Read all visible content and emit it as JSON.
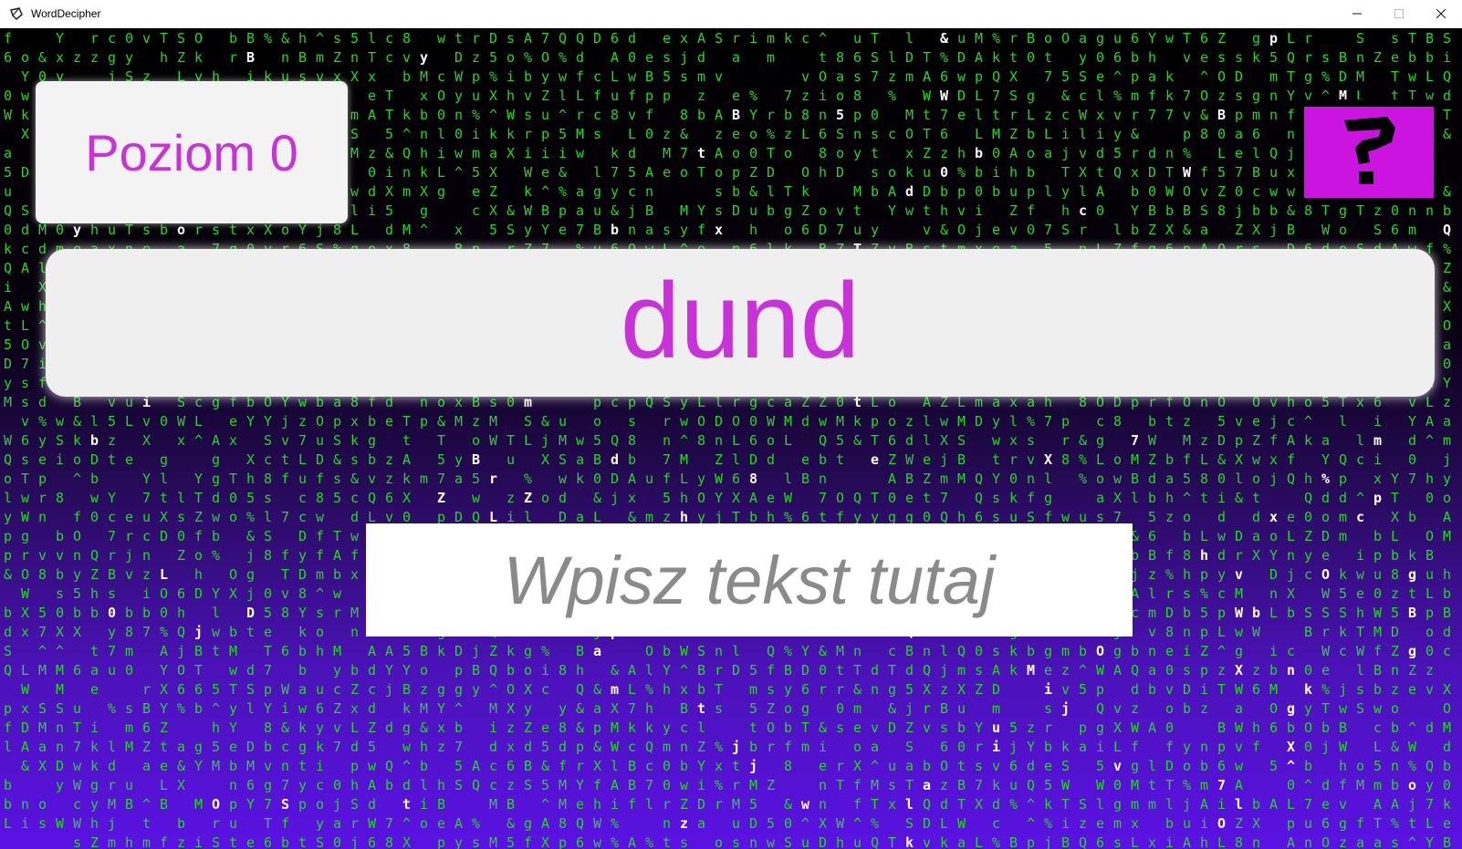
{
  "window": {
    "title": "WordDecipher",
    "minimize_label": "—",
    "maximize_label": "☐",
    "close_label": "✕"
  },
  "game": {
    "level_label": "Poziom 0",
    "word": "dund",
    "help_icon": "question-mark-icon",
    "input_placeholder": "Wpisz tekst tutaj",
    "input_value": ""
  },
  "background": {
    "rain_charset": "SLYwMfyXZBbnlkxiAOD0Qm5678&^%TWabcdeghjoprstuvz"
  },
  "colors": {
    "accent": "#c832d8",
    "help_button": "#cc14e0",
    "rain_green": "#22d822",
    "rain_highlight": "#ffffff",
    "gradient_bottom": "#5a12e2"
  }
}
